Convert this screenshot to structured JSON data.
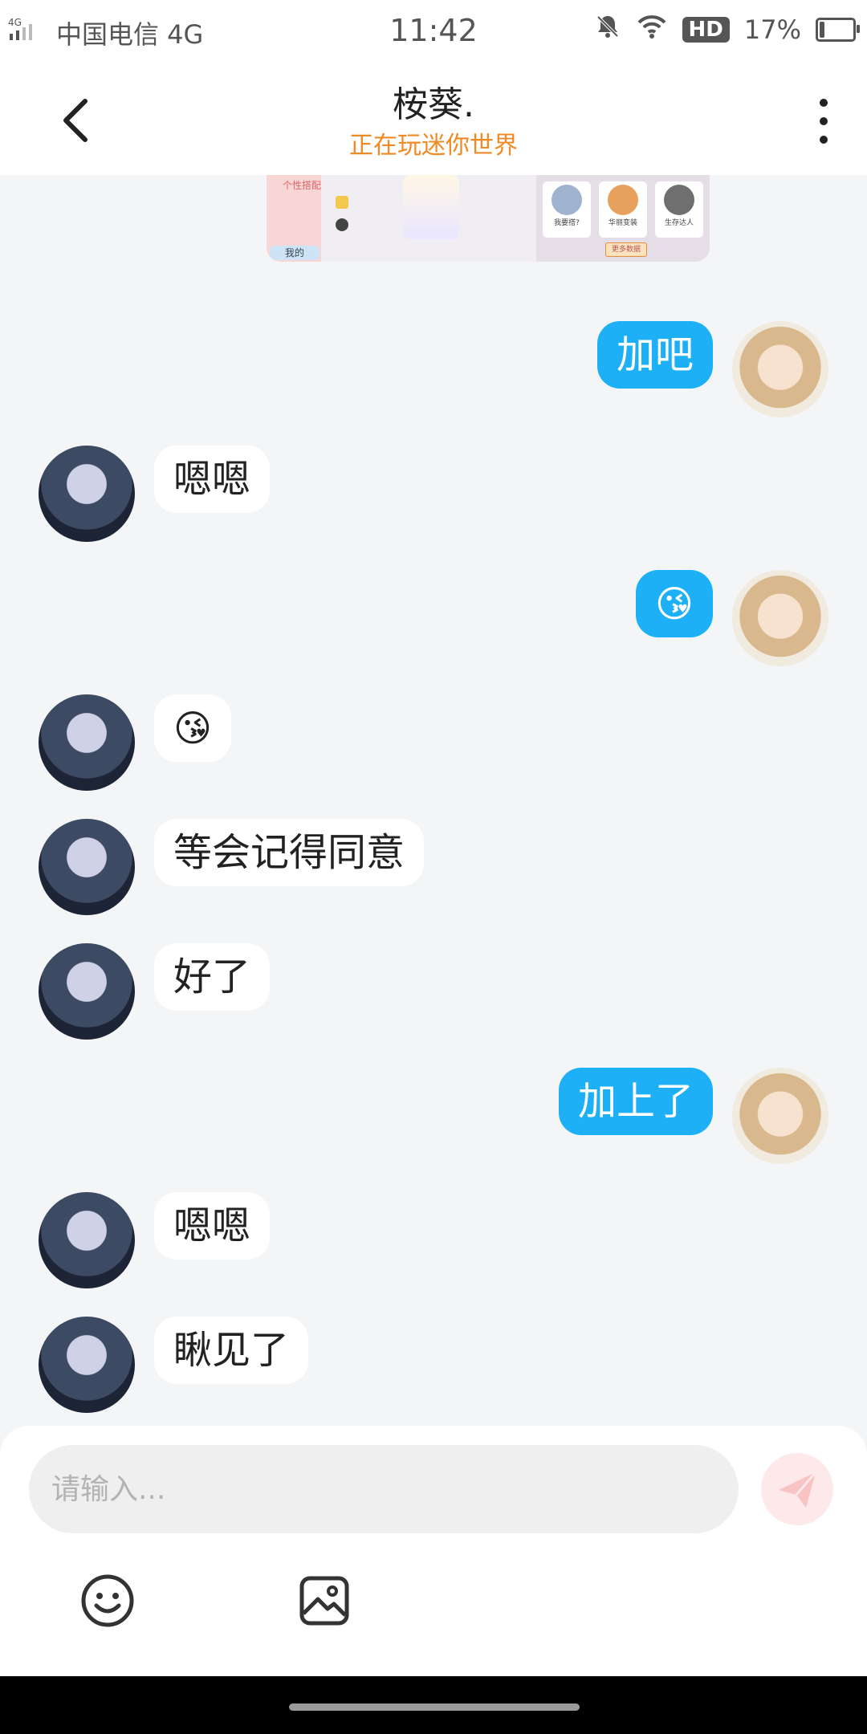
{
  "status_bar": {
    "network": "4G",
    "carrier": "中国电信 4G",
    "time": "11:42",
    "hd": "HD",
    "battery": "17%",
    "battery_level": 0.17
  },
  "header": {
    "title": "桉葵.",
    "subtitle": "正在玩迷你世界"
  },
  "game_card": {
    "left_label": "个性搭配",
    "me_label": "我的",
    "items": [
      {
        "label": "我要搭?"
      },
      {
        "label": "华丽变装"
      },
      {
        "label": "生存达人"
      }
    ],
    "more_button": "更多数据"
  },
  "messages": [
    {
      "from": "me",
      "type": "text",
      "text": "加吧"
    },
    {
      "from": "other",
      "type": "text",
      "text": "嗯嗯"
    },
    {
      "from": "me",
      "type": "emoji",
      "text": "😘"
    },
    {
      "from": "other",
      "type": "emoji",
      "text": "😘"
    },
    {
      "from": "other",
      "type": "text",
      "text": "等会记得同意"
    },
    {
      "from": "other",
      "type": "text",
      "text": "好了"
    },
    {
      "from": "me",
      "type": "text",
      "text": "加上了"
    },
    {
      "from": "other",
      "type": "text",
      "text": "嗯嗯"
    },
    {
      "from": "other",
      "type": "text",
      "text": "瞅见了"
    }
  ],
  "composer": {
    "placeholder": "请输入...",
    "emoji_icon": "smiley-icon",
    "image_icon": "image-icon",
    "send_icon": "paper-plane-icon"
  },
  "colors": {
    "my_bubble": "#1eb0f6",
    "subtitle": "#f08a24",
    "background": "#f4f5f7"
  }
}
